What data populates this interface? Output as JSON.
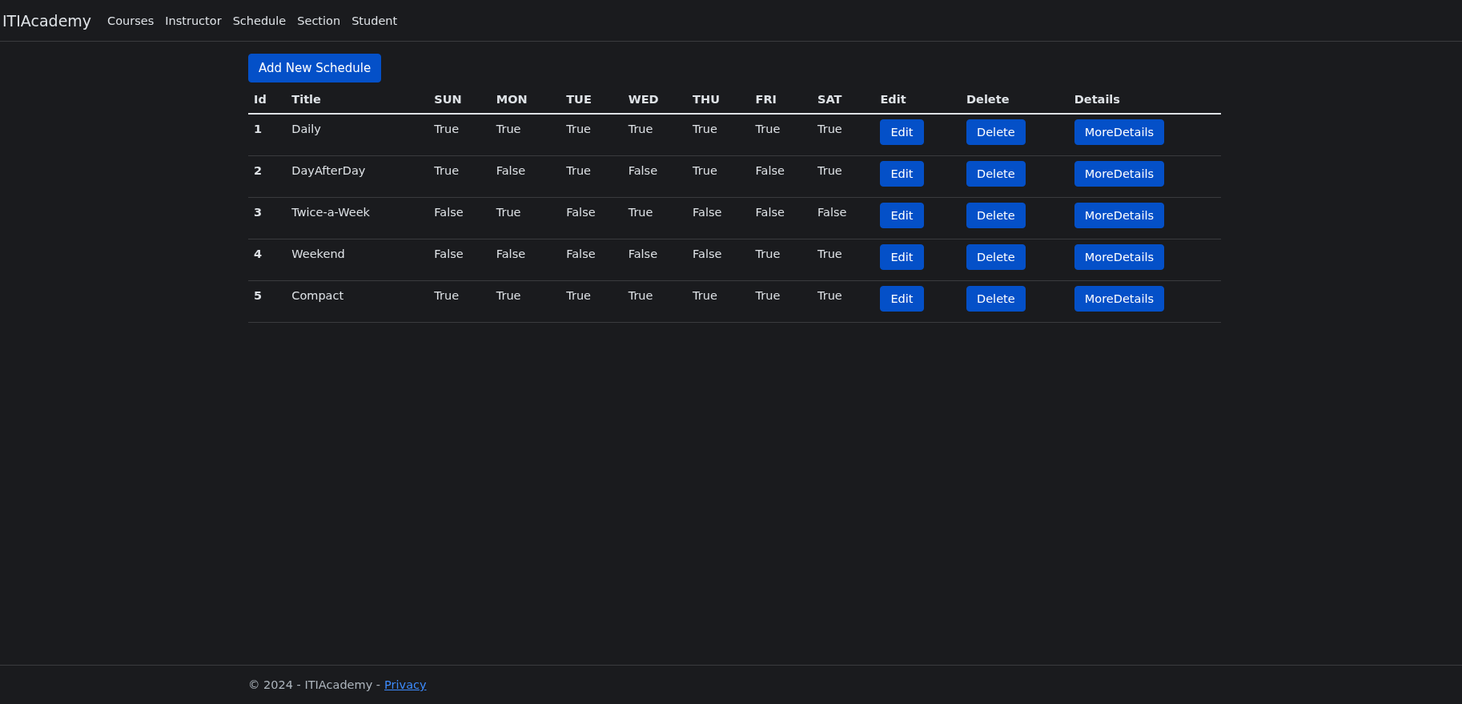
{
  "navbar": {
    "brand": "ITIAcademy",
    "links": [
      "Courses",
      "Instructor",
      "Schedule",
      "Section",
      "Student"
    ]
  },
  "add_button": "Add New Schedule",
  "table": {
    "columns": [
      "Id",
      "Title",
      "SUN",
      "MON",
      "TUE",
      "WED",
      "THU",
      "FRI",
      "SAT",
      "Edit",
      "Delete",
      "Details"
    ],
    "rows": [
      {
        "id": "1",
        "title": "Daily",
        "days": [
          "True",
          "True",
          "True",
          "True",
          "True",
          "True",
          "True"
        ],
        "actions": [
          "Edit",
          "Delete",
          "MoreDetails"
        ]
      },
      {
        "id": "2",
        "title": "DayAfterDay",
        "days": [
          "True",
          "False",
          "True",
          "False",
          "True",
          "False",
          "True"
        ],
        "actions": [
          "Edit",
          "Delete",
          "MoreDetails"
        ]
      },
      {
        "id": "3",
        "title": "Twice-a-Week",
        "days": [
          "False",
          "True",
          "False",
          "True",
          "False",
          "False",
          "False"
        ],
        "actions": [
          "Edit",
          "Delete",
          "MoreDetails"
        ]
      },
      {
        "id": "4",
        "title": "Weekend",
        "days": [
          "False",
          "False",
          "False",
          "False",
          "False",
          "True",
          "True"
        ],
        "actions": [
          "Edit",
          "Delete",
          "MoreDetails"
        ]
      },
      {
        "id": "5",
        "title": "Compact",
        "days": [
          "True",
          "True",
          "True",
          "True",
          "True",
          "True",
          "True"
        ],
        "actions": [
          "Edit",
          "Delete",
          "MoreDetails"
        ]
      }
    ]
  },
  "footer": {
    "text": "© 2024 - ITIAcademy -",
    "link": "Privacy"
  }
}
